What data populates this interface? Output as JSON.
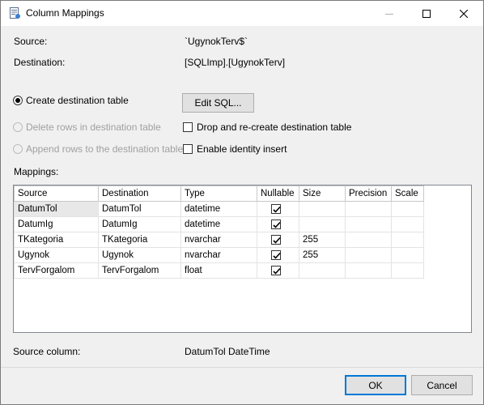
{
  "window": {
    "title": "Column Mappings"
  },
  "source": {
    "label": "Source:",
    "value": "`UgynokTerv$`"
  },
  "destination": {
    "label": "Destination:",
    "value": "[SQLImp].[UgynokTerv]"
  },
  "options": {
    "create_table": "Create destination table",
    "edit_sql": "Edit SQL...",
    "delete_rows": "Delete rows in destination table",
    "drop_recreate": "Drop and re-create destination table",
    "append_rows": "Append rows to the destination table",
    "identity_insert": "Enable identity insert"
  },
  "mappings": {
    "label": "Mappings:",
    "columns": [
      "Source",
      "Destination",
      "Type",
      "Nullable",
      "Size",
      "Precision",
      "Scale"
    ],
    "rows": [
      {
        "source": "DatumTol",
        "destination": "DatumTol",
        "type": "datetime",
        "nullable": true,
        "size": "",
        "precision": "",
        "scale": ""
      },
      {
        "source": "DatumIg",
        "destination": "DatumIg",
        "type": "datetime",
        "nullable": true,
        "size": "",
        "precision": "",
        "scale": ""
      },
      {
        "source": "TKategoria",
        "destination": "TKategoria",
        "type": "nvarchar",
        "nullable": true,
        "size": "255",
        "precision": "",
        "scale": ""
      },
      {
        "source": "Ugynok",
        "destination": "Ugynok",
        "type": "nvarchar",
        "nullable": true,
        "size": "255",
        "precision": "",
        "scale": ""
      },
      {
        "source": "TervForgalom",
        "destination": "TervForgalom",
        "type": "float",
        "nullable": true,
        "size": "",
        "precision": "",
        "scale": ""
      }
    ]
  },
  "source_column": {
    "label": "Source column:",
    "value": "DatumTol DateTime"
  },
  "buttons": {
    "ok": "OK",
    "cancel": "Cancel"
  },
  "colors": {
    "accent": "#0078d7",
    "selected_cell": "#e8e8e8"
  }
}
